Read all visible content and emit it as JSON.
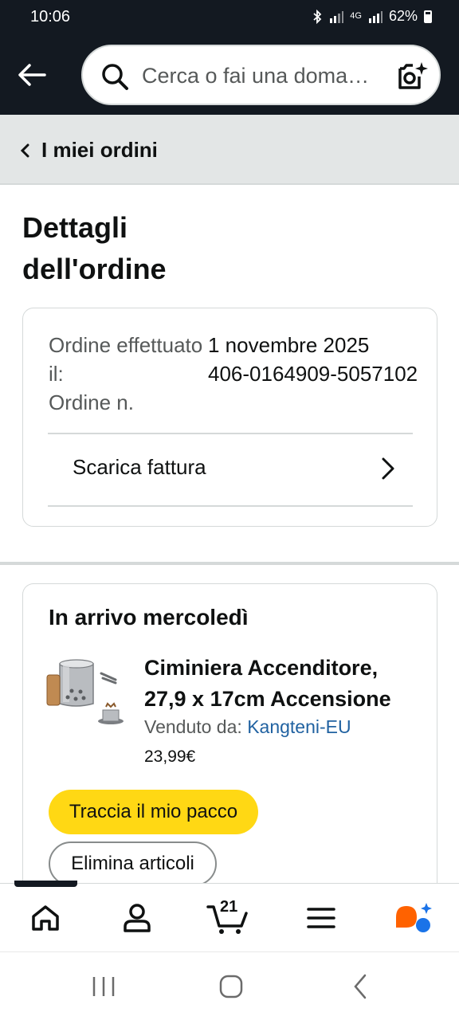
{
  "status_bar": {
    "time": "10:06",
    "network": "4G",
    "battery": "62%"
  },
  "header": {
    "search_placeholder": "Cerca o fai una domanda"
  },
  "breadcrumb": {
    "label": "I miei ordini"
  },
  "page": {
    "title": "Dettagli dell'ordine"
  },
  "order_summary": {
    "placed_label": "Ordine effettuato il:",
    "number_label": "Ordine n.",
    "placed_value": "1 novembre 2025",
    "number_value": "406-0164909-5057102",
    "invoice_label": "Scarica fattura"
  },
  "delivery": {
    "title": "In arrivo mercoledì",
    "product_title_line1": "Ciminiera Accenditore,",
    "product_title_line2": "27,9 x 17cm Accensione",
    "seller_prefix": "Venduto da: ",
    "seller_name": "Kangteni-EU",
    "price": "23,99€",
    "track_button": "Traccia il mio pacco",
    "remove_button": "Elimina articoli"
  },
  "bottom_nav": {
    "cart_count": "21"
  },
  "icons": [
    "back-arrow-icon",
    "search-icon",
    "camera-search-icon",
    "chevron-left-icon",
    "chevron-right-icon",
    "home-icon",
    "account-icon",
    "cart-icon",
    "menu-icon",
    "rufus-icon"
  ],
  "colors": {
    "header_bg": "#131921",
    "accent_yellow": "#ffd814",
    "link_blue": "#2162a1",
    "rufus_orange": "#ff6200",
    "rufus_blue": "#1a73e8"
  }
}
